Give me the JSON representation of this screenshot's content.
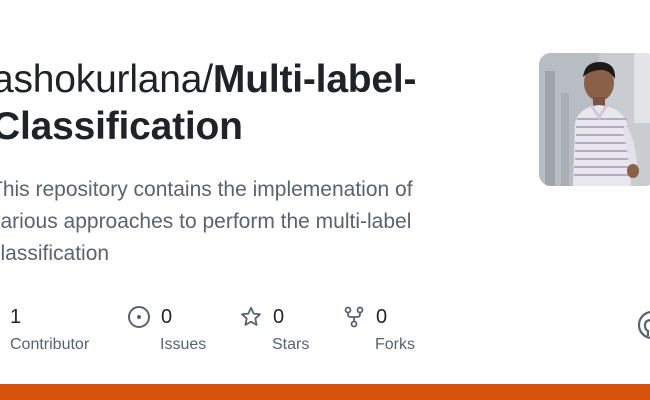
{
  "repo": {
    "owner": "ashokurlana/",
    "name": "Multi-label-Classification",
    "description": "This repository contains the implemenation of various approaches to perform the multi-label classification"
  },
  "stats": [
    {
      "value": "1",
      "label": "Contributor",
      "icon": "people-icon"
    },
    {
      "value": "0",
      "label": "Issues",
      "icon": "issue-opened-icon"
    },
    {
      "value": "0",
      "label": "Stars",
      "icon": "star-icon"
    },
    {
      "value": "0",
      "label": "Forks",
      "icon": "repo-forked-icon"
    }
  ],
  "colors": {
    "accent_bar": "#d9520b",
    "title_text": "#1f2328",
    "muted_text": "#59636e"
  }
}
